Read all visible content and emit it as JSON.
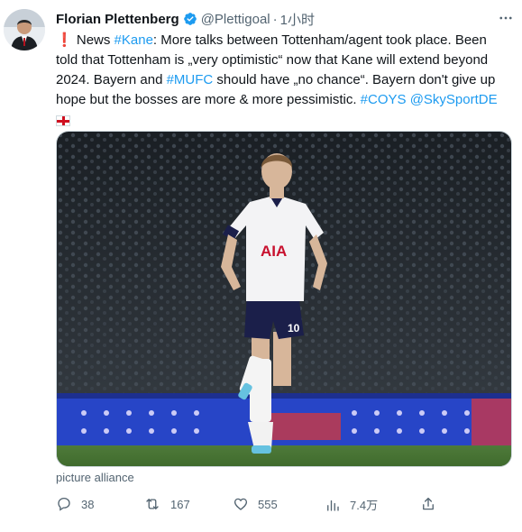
{
  "author": {
    "name": "Florian Plettenberg",
    "handle": "@Plettigoal",
    "separator": "·",
    "time": "1小时"
  },
  "tweet": {
    "line1": {
      "alert": "❗",
      "prefix": " News ",
      "tag_kane": "#Kane",
      "rest": ": More talks between Tottenham/agent took place. Been"
    },
    "line2": "told that Tottenham is „very optimistic“ now that Kane will extend beyond",
    "line3": {
      "prefix": "2024. Bayern and ",
      "tag_mufc": "#MUFC",
      "rest": " should have „no chance“. Bayern don't give up"
    },
    "line4": {
      "prefix": "hope but the bosses are more & more pessimistic. ",
      "tag_coys": "#COYS",
      "space": " ",
      "mention": "@SkySportDE"
    },
    "flag": "england-flag"
  },
  "media": {
    "caption": "picture alliance",
    "shirt_sponsor": "AIA",
    "shirt_number": "10"
  },
  "actions": {
    "reply_count": "38",
    "retweet_count": "167",
    "like_count": "555",
    "view_count": "7.4万"
  },
  "colors": {
    "link": "#1d9bf0",
    "secondary_text": "#536471",
    "verified": "#1d9bf0"
  }
}
